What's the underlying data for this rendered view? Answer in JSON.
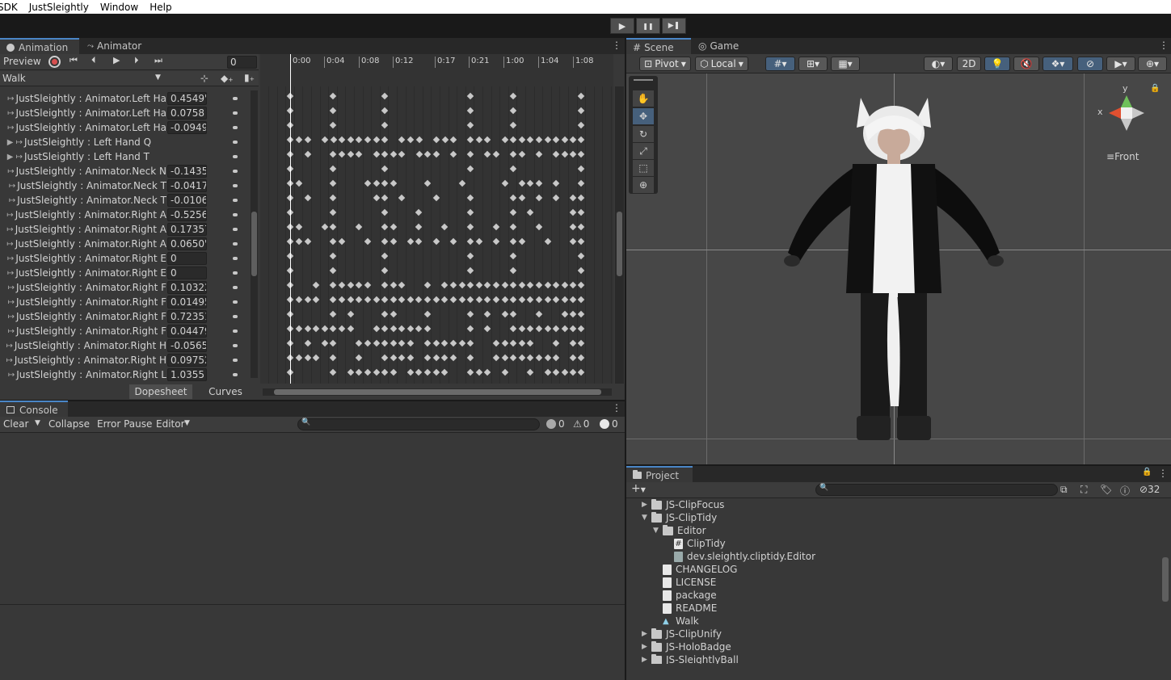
{
  "menu": {
    "items": [
      " SDK",
      "JustSleightly",
      "Window",
      "Help"
    ]
  },
  "playbar": {
    "play": "▶",
    "pause": "❚❚",
    "step": "▶❚"
  },
  "animation": {
    "tabs": [
      "Animation",
      "Animator"
    ],
    "preview_label": "Preview",
    "frame_value": "0",
    "clip_name": "Walk",
    "timeline_labels": [
      "0:00",
      "0:04",
      "0:08",
      "0:12",
      "0:17",
      "0:21",
      "1:00",
      "1:04",
      "1:08"
    ],
    "rows": [
      {
        "label": "JustSleightly : Animator.Left Ha",
        "value": "0.4549'",
        "expand": false
      },
      {
        "label": "JustSleightly : Animator.Left Ha",
        "value": "0.0758",
        "expand": false
      },
      {
        "label": "JustSleightly : Animator.Left Ha",
        "value": "-0.0949",
        "expand": false
      },
      {
        "label": "JustSleightly : Left Hand Q",
        "value": "",
        "expand": true
      },
      {
        "label": "JustSleightly : Left Hand T",
        "value": "",
        "expand": true
      },
      {
        "label": "JustSleightly : Animator.Neck N",
        "value": "-0.1435",
        "expand": false
      },
      {
        "label": "JustSleightly : Animator.Neck T",
        "value": "-0.0417",
        "expand": false
      },
      {
        "label": "JustSleightly : Animator.Neck T",
        "value": "-0.0106",
        "expand": false
      },
      {
        "label": "JustSleightly : Animator.Right A",
        "value": "-0.5256",
        "expand": false
      },
      {
        "label": "JustSleightly : Animator.Right A",
        "value": "0.17357",
        "expand": false
      },
      {
        "label": "JustSleightly : Animator.Right A",
        "value": "0.0650'",
        "expand": false
      },
      {
        "label": "JustSleightly : Animator.Right E",
        "value": "0",
        "expand": false
      },
      {
        "label": "JustSleightly : Animator.Right E",
        "value": "0",
        "expand": false
      },
      {
        "label": "JustSleightly : Animator.Right F",
        "value": "0.10322",
        "expand": false
      },
      {
        "label": "JustSleightly : Animator.Right F",
        "value": "0.01495",
        "expand": false
      },
      {
        "label": "JustSleightly : Animator.Right F",
        "value": "0.72351",
        "expand": false
      },
      {
        "label": "JustSleightly : Animator.Right F",
        "value": "0.04479",
        "expand": false
      },
      {
        "label": "JustSleightly : Animator.Right H",
        "value": "-0.0565",
        "expand": false
      },
      {
        "label": "JustSleightly : Animator.Right H",
        "value": "0.09752",
        "expand": false
      },
      {
        "label": "JustSleightly : Animator.Right L",
        "value": "1.0355",
        "expand": false
      }
    ],
    "bottom_tabs": [
      "Dopesheet",
      "Curves"
    ]
  },
  "console": {
    "tab": "Console",
    "buttons": [
      "Clear",
      "Collapse",
      "Error Pause",
      "Editor"
    ],
    "counts": {
      "log": "0",
      "warn": "0",
      "error": "0"
    }
  },
  "scene": {
    "tabs": [
      "Scene",
      "Game"
    ],
    "pivot": "Pivot",
    "local": "Local",
    "mode_2d": "2D",
    "gizmo_view": "Front",
    "axis_x": "x",
    "axis_y": "y"
  },
  "project": {
    "tab": "Project",
    "hidden_count": "32",
    "items": [
      {
        "label": "JS-ClipFocus",
        "type": "folder",
        "depth": 0,
        "arrow": "▶"
      },
      {
        "label": "JS-ClipTidy",
        "type": "folder",
        "depth": 0,
        "arrow": "▼"
      },
      {
        "label": "Editor",
        "type": "folder-open",
        "depth": 1,
        "arrow": "▼"
      },
      {
        "label": "ClipTidy",
        "type": "script",
        "depth": 2,
        "arrow": ""
      },
      {
        "label": "dev.sleightly.cliptidy.Editor",
        "type": "asmdef",
        "depth": 2,
        "arrow": ""
      },
      {
        "label": "CHANGELOG",
        "type": "doc",
        "depth": 1,
        "arrow": ""
      },
      {
        "label": "LICENSE",
        "type": "doc",
        "depth": 1,
        "arrow": ""
      },
      {
        "label": "package",
        "type": "doc",
        "depth": 1,
        "arrow": ""
      },
      {
        "label": "README",
        "type": "doc",
        "depth": 1,
        "arrow": ""
      },
      {
        "label": "Walk",
        "type": "anim",
        "depth": 1,
        "arrow": ""
      },
      {
        "label": "JS-ClipUnify",
        "type": "folder",
        "depth": 0,
        "arrow": "▶"
      },
      {
        "label": "JS-HoloBadge",
        "type": "folder",
        "depth": 0,
        "arrow": "▶"
      },
      {
        "label": "JS-SleightlyBall",
        "type": "folder",
        "depth": 0,
        "arrow": "▶"
      }
    ]
  },
  "colors": {
    "accent": "#4a86c7",
    "panel": "#383838",
    "scene_bg": "#474747"
  }
}
